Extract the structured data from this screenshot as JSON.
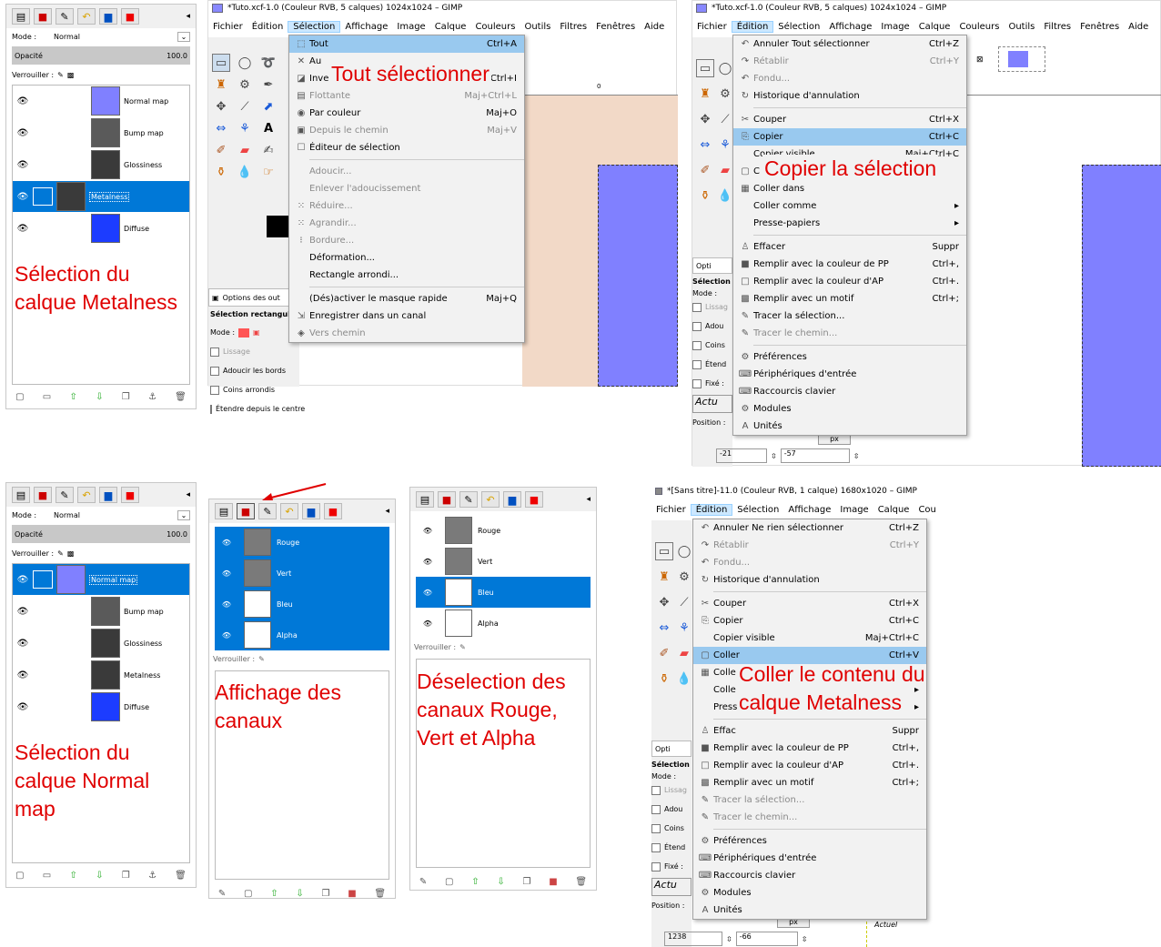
{
  "colors": {
    "accent": "#0078d7",
    "annotation": "#e00000",
    "canvas": "#8080ff",
    "menu_highlight": "#99c9ef"
  },
  "panel1": {
    "mode_label": "Mode :",
    "mode_value": "Normal",
    "opacity_label": "Opacité",
    "opacity_value": "100.0",
    "lock_label": "Verrouiller :",
    "layers": [
      {
        "name": "Normal map",
        "thumb": "#8080ff"
      },
      {
        "name": "Bump map",
        "thumb": "#5a5a5a"
      },
      {
        "name": "Glossiness",
        "thumb": "#3a3a3a"
      },
      {
        "name": "Metalness",
        "thumb": "#3a3a3a"
      },
      {
        "name": "Diffuse",
        "thumb": "#1c3cff"
      }
    ],
    "annotation": "Sélection du calque Metalness"
  },
  "win1": {
    "title": "*Tuto.xcf-1.0 (Couleur RVB, 5 calques) 1024x1024 – GIMP",
    "menubar": [
      "Fichier",
      "Édition",
      "Sélection",
      "Affichage",
      "Image",
      "Calque",
      "Couleurs",
      "Outils",
      "Filtres",
      "Fenêtres",
      "Aide"
    ],
    "menu": [
      {
        "icon": "⬚",
        "label": "Tout",
        "shortcut": "Ctrl+A",
        "hl": true
      },
      {
        "icon": "✕",
        "label": "Au",
        "shortcut": ""
      },
      {
        "icon": "◪",
        "label": "Inverser",
        "shortcut": "Ctrl+I"
      },
      {
        "icon": "▤",
        "label": "Flottante",
        "shortcut": "Maj+Ctrl+L",
        "dis": true
      },
      {
        "icon": "◉",
        "label": "Par couleur",
        "shortcut": "Maj+O"
      },
      {
        "icon": "▣",
        "label": "Depuis le chemin",
        "shortcut": "Maj+V",
        "dis": true
      },
      {
        "icon": "☐",
        "label": "Éditeur de sélection",
        "shortcut": ""
      },
      {
        "sep": true
      },
      {
        "icon": "",
        "label": "Adoucir...",
        "shortcut": "",
        "dis": true
      },
      {
        "icon": "",
        "label": "Enlever l'adoucissement",
        "shortcut": "",
        "dis": true
      },
      {
        "icon": "⁙",
        "label": "Réduire...",
        "shortcut": "",
        "dis": true
      },
      {
        "icon": "⁙",
        "label": "Agrandir...",
        "shortcut": "",
        "dis": true
      },
      {
        "icon": "⁝",
        "label": "Bordure...",
        "shortcut": "",
        "dis": true
      },
      {
        "icon": "",
        "label": "Déformation...",
        "shortcut": ""
      },
      {
        "icon": "",
        "label": "Rectangle arrondi...",
        "shortcut": ""
      },
      {
        "sep": true
      },
      {
        "icon": "",
        "label": "(Dés)activer le masque rapide",
        "shortcut": "Maj+Q"
      },
      {
        "icon": "⇲",
        "label": "Enregistrer dans un canal",
        "shortcut": ""
      },
      {
        "icon": "◈",
        "label": "Vers chemin",
        "shortcut": "",
        "dis": true
      }
    ],
    "options_tab": "Options des out",
    "opt_title": "Sélection rectangulai",
    "opt_mode": "Mode :",
    "opt_lissage": "Lissage",
    "opt_adoucir": "Adoucir les bords",
    "opt_coins": "Coins arrondis",
    "opt_etendre": "Étendre depuis le centre",
    "ruler_mark": "0",
    "annotation": "Tout sélectionner"
  },
  "win2": {
    "title": "*Tuto.xcf-1.0 (Couleur RVB, 5 calques) 1024x1024 – GIMP",
    "menubar": [
      "Fichier",
      "Édition",
      "Sélection",
      "Affichage",
      "Image",
      "Calque",
      "Couleurs",
      "Outils",
      "Filtres",
      "Fenêtres",
      "Aide"
    ],
    "menu": [
      {
        "icon": "↶",
        "label": "Annuler Tout sélectionner",
        "shortcut": "Ctrl+Z"
      },
      {
        "icon": "↷",
        "label": "Rétablir",
        "shortcut": "Ctrl+Y",
        "dis": true
      },
      {
        "icon": "↶",
        "label": "Fondu...",
        "shortcut": "",
        "dis": true
      },
      {
        "icon": "↻",
        "label": "Historique d'annulation",
        "shortcut": ""
      },
      {
        "sep": true
      },
      {
        "icon": "✂",
        "label": "Couper",
        "shortcut": "Ctrl+X"
      },
      {
        "icon": "⎘",
        "label": "Copier",
        "shortcut": "Ctrl+C",
        "hl": true
      },
      {
        "icon": "",
        "label": "Copier visible",
        "shortcut": "Maj+Ctrl+C"
      },
      {
        "icon": "▢",
        "label": "C",
        "shortcut": ""
      },
      {
        "icon": "▦",
        "label": "Coller dans",
        "shortcut": ""
      },
      {
        "icon": "",
        "label": "Coller comme",
        "shortcut": "▸"
      },
      {
        "icon": "",
        "label": "Presse-papiers",
        "shortcut": "▸"
      },
      {
        "sep": true
      },
      {
        "icon": "♙",
        "label": "Effacer",
        "shortcut": "Suppr"
      },
      {
        "icon": "■",
        "label": "Remplir avec la couleur de PP",
        "shortcut": "Ctrl+,"
      },
      {
        "icon": "□",
        "label": "Remplir avec la couleur d'AP",
        "shortcut": "Ctrl+."
      },
      {
        "icon": "▩",
        "label": "Remplir avec un motif",
        "shortcut": "Ctrl+;"
      },
      {
        "icon": "✎",
        "label": "Tracer la sélection...",
        "shortcut": ""
      },
      {
        "icon": "✎",
        "label": "Tracer le chemin...",
        "shortcut": "",
        "dis": true
      },
      {
        "sep": true
      },
      {
        "icon": "⚙",
        "label": "Préférences",
        "shortcut": ""
      },
      {
        "icon": "⌨",
        "label": "Périphériques d'entrée",
        "shortcut": ""
      },
      {
        "icon": "⌨",
        "label": "Raccourcis clavier",
        "shortcut": ""
      },
      {
        "icon": "⚙",
        "label": "Modules",
        "shortcut": ""
      },
      {
        "icon": "A",
        "label": "Unités",
        "shortcut": ""
      }
    ],
    "opt_tab": "Opti",
    "opt_sel": "Sélection",
    "opt_mode": "Mode :",
    "opt_lines": [
      "Lissag",
      "Adou",
      "Coins",
      "Étend",
      "Fixé :"
    ],
    "actu": "Actu",
    "position_label": "Position :",
    "unit": "px",
    "pos_x": "-21",
    "pos_y": "-57",
    "annotation": "Copier la sélection"
  },
  "panel2": {
    "mode_label": "Mode :",
    "mode_value": "Normal",
    "opacity_label": "Opacité",
    "opacity_value": "100.0",
    "lock_label": "Verrouiller :",
    "layers": [
      {
        "name": "Normal map",
        "thumb": "#8080ff"
      },
      {
        "name": "Bump map",
        "thumb": "#5a5a5a"
      },
      {
        "name": "Glossiness",
        "thumb": "#3a3a3a"
      },
      {
        "name": "Metalness",
        "thumb": "#3a3a3a"
      },
      {
        "name": "Diffuse",
        "thumb": "#1c3cff"
      }
    ],
    "annotation": "Sélection du calque Normal map"
  },
  "panel3": {
    "channels": [
      "Rouge",
      "Vert",
      "Bleu",
      "Alpha"
    ],
    "lock_label": "Verrouiller :",
    "annotation": "Affichage des canaux"
  },
  "panel4": {
    "channels": [
      "Rouge",
      "Vert",
      "Bleu",
      "Alpha"
    ],
    "lock_label": "Verrouiller :",
    "annotation": "Déselection des canaux Rouge, Vert et Alpha"
  },
  "win3": {
    "title": "*[Sans titre]-11.0 (Couleur RVB, 1 calque) 1680x1020 – GIMP",
    "menubar": [
      "Fichier",
      "Édition",
      "Sélection",
      "Affichage",
      "Image",
      "Calque",
      "Cou"
    ],
    "menu": [
      {
        "icon": "↶",
        "label": "Annuler Ne rien sélectionner",
        "shortcut": "Ctrl+Z"
      },
      {
        "icon": "↷",
        "label": "Rétablir",
        "shortcut": "Ctrl+Y",
        "dis": true
      },
      {
        "icon": "↶",
        "label": "Fondu...",
        "shortcut": "",
        "dis": true
      },
      {
        "icon": "↻",
        "label": "Historique d'annulation",
        "shortcut": ""
      },
      {
        "sep": true
      },
      {
        "icon": "✂",
        "label": "Couper",
        "shortcut": "Ctrl+X"
      },
      {
        "icon": "⎘",
        "label": "Copier",
        "shortcut": "Ctrl+C"
      },
      {
        "icon": "",
        "label": "Copier visible",
        "shortcut": "Maj+Ctrl+C"
      },
      {
        "icon": "▢",
        "label": "Coller",
        "shortcut": "Ctrl+V",
        "hl": true
      },
      {
        "icon": "▦",
        "label": "Colle",
        "shortcut": ""
      },
      {
        "icon": "",
        "label": "Colle",
        "shortcut": "▸"
      },
      {
        "icon": "",
        "label": "Press",
        "shortcut": "▸"
      },
      {
        "sep": true
      },
      {
        "icon": "♙",
        "label": "Effac",
        "shortcut": "Suppr"
      },
      {
        "icon": "■",
        "label": "Remplir avec la couleur de PP",
        "shortcut": "Ctrl+,"
      },
      {
        "icon": "□",
        "label": "Remplir avec la couleur d'AP",
        "shortcut": "Ctrl+."
      },
      {
        "icon": "▩",
        "label": "Remplir avec un motif",
        "shortcut": "Ctrl+;"
      },
      {
        "icon": "✎",
        "label": "Tracer la sélection...",
        "shortcut": "",
        "dis": true
      },
      {
        "icon": "✎",
        "label": "Tracer le chemin...",
        "shortcut": "",
        "dis": true
      },
      {
        "sep": true
      },
      {
        "icon": "⚙",
        "label": "Préférences",
        "shortcut": ""
      },
      {
        "icon": "⌨",
        "label": "Périphériques d'entrée",
        "shortcut": ""
      },
      {
        "icon": "⌨",
        "label": "Raccourcis clavier",
        "shortcut": ""
      },
      {
        "icon": "⚙",
        "label": "Modules",
        "shortcut": ""
      },
      {
        "icon": "A",
        "label": "Unités",
        "shortcut": ""
      }
    ],
    "opt_tab": "Opti",
    "opt_sel": "Sélection",
    "opt_mode": "Mode :",
    "opt_lines": [
      "Lissag",
      "Adou",
      "Coins",
      "Étend",
      "Fixé :"
    ],
    "actu": "Actu",
    "actuel": "Actuel",
    "position_label": "Position :",
    "unit": "px",
    "pos_x": "1238",
    "pos_y": "-66",
    "annotation": "Coller le contenu du calque Metalness"
  }
}
